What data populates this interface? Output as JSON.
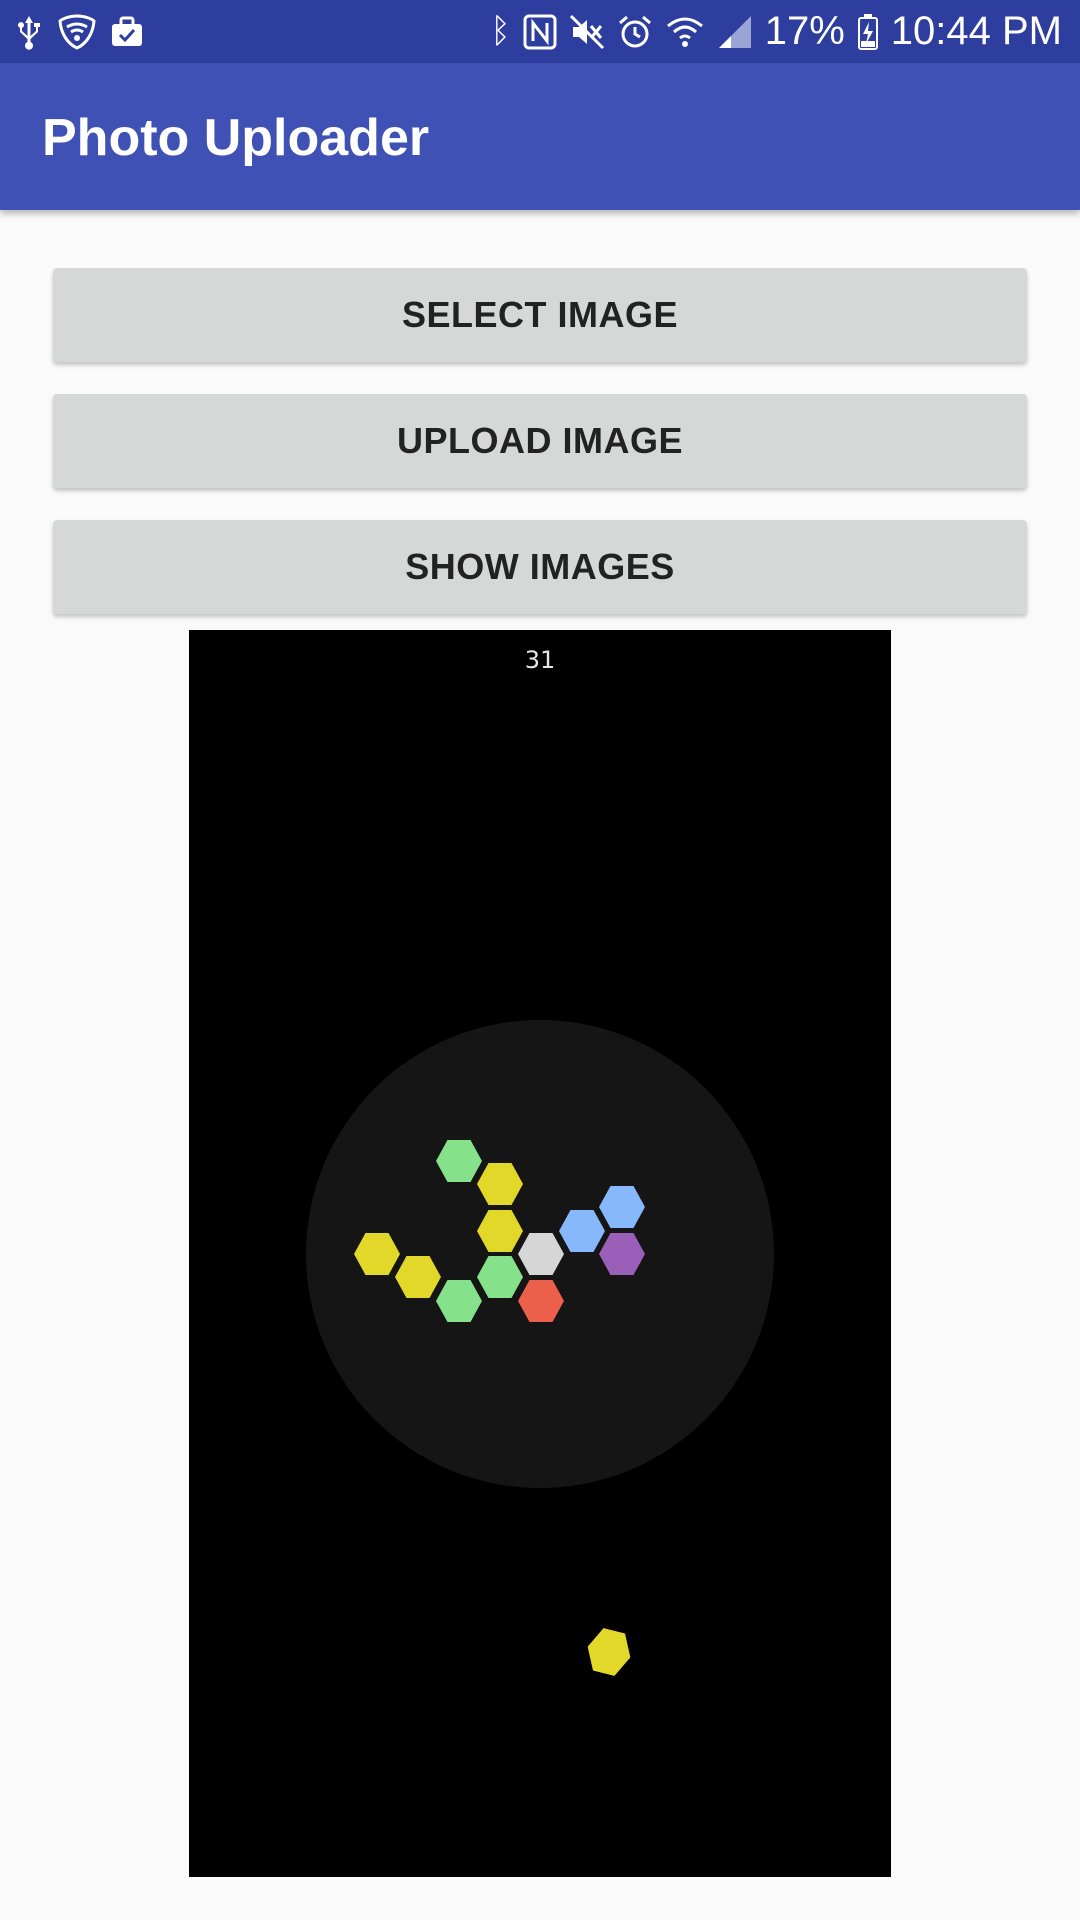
{
  "status_bar": {
    "left_icons": [
      "usb-icon",
      "shield-icon",
      "briefcase-icon"
    ],
    "right_icons": [
      "bluetooth-icon",
      "nfc-icon",
      "mute-icon",
      "alarm-icon",
      "wifi-icon",
      "signal-icon",
      "battery-charging-icon"
    ],
    "battery": "17%",
    "time": "10:44 PM"
  },
  "app_bar": {
    "title": "Photo Uploader",
    "color": "#3f51b5"
  },
  "buttons": {
    "select": "SELECT IMAGE",
    "upload": "UPLOAD IMAGE",
    "show": "SHOW IMAGES"
  },
  "game": {
    "score": "31",
    "colors": {
      "yellow": "#e2d82a",
      "green": "#86e28a",
      "blue": "#86b8fb",
      "purple": "#9a5fb8",
      "gray": "#d6d6d6",
      "red": "#ec5f4a"
    },
    "board_hexes": [
      "green",
      "yellow",
      "yellow",
      "blue",
      "blue",
      "yellow",
      "gray",
      "purple",
      "yellow",
      "green",
      "green",
      "red"
    ],
    "falling_hex": "yellow"
  }
}
